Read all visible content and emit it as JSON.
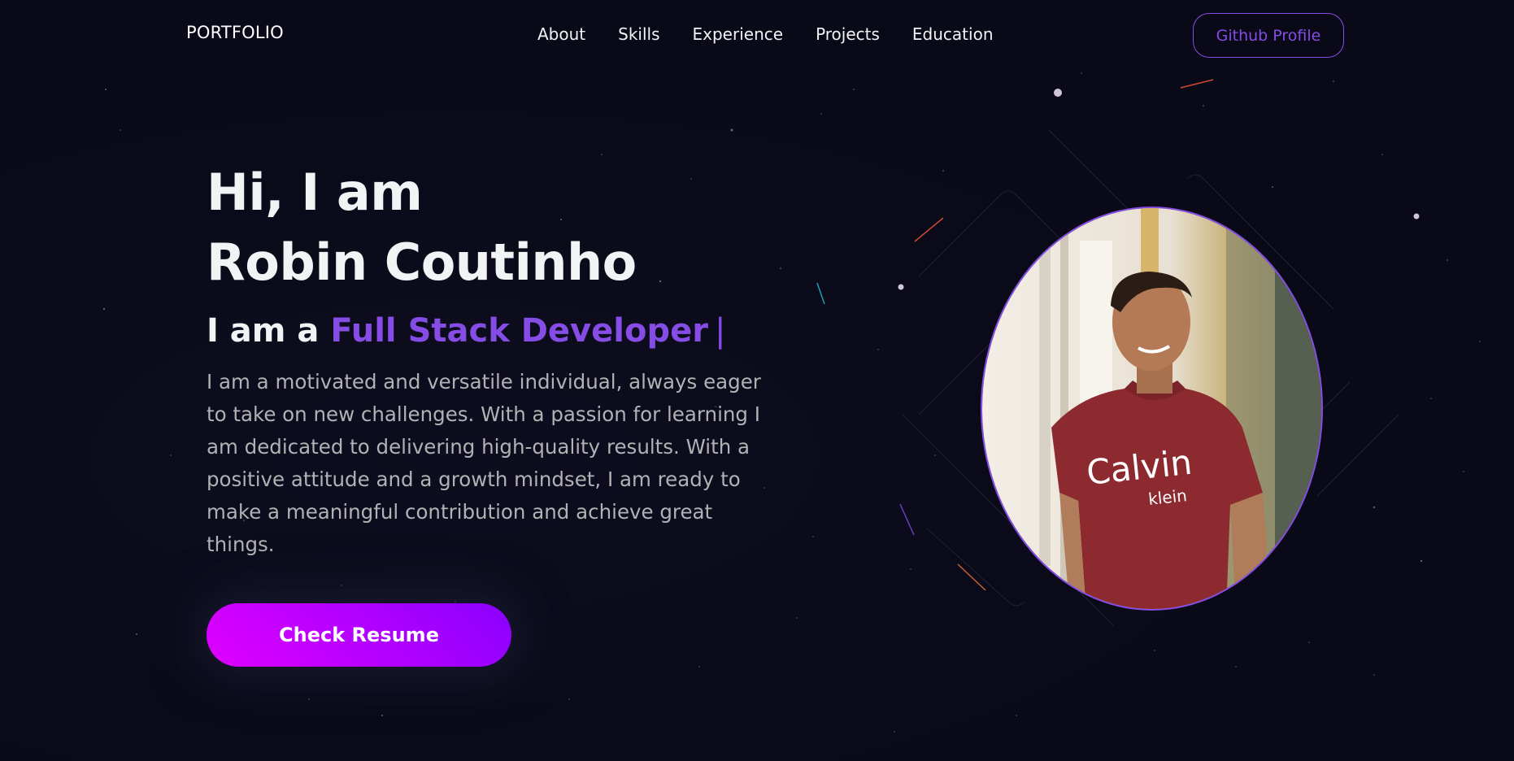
{
  "nav": {
    "logo": "PORTFOLIO",
    "links": [
      "About",
      "Skills",
      "Experience",
      "Projects",
      "Education"
    ],
    "github_label": "Github Profile"
  },
  "hero": {
    "greeting_line1": "Hi, I am",
    "greeting_line2": "Robin Coutinho",
    "role_prefix": "I am a",
    "role_value": "Full Stack Developer",
    "role_cursor": "|",
    "bio": "I am a motivated and versatile individual, always eager to take on new challenges. With a passion for learning I am dedicated to delivering high-quality results. With a positive attitude and a growth mindset, I am ready to make a meaningful contribution and achieve great things.",
    "resume_label": "Check Resume"
  },
  "colors": {
    "background": "#090917",
    "accent": "#854ce6",
    "text_primary": "#f2f3f4",
    "text_secondary": "#b1b2b3",
    "button_gradient_start": "#e000ff",
    "button_gradient_end": "#8a00ff"
  }
}
